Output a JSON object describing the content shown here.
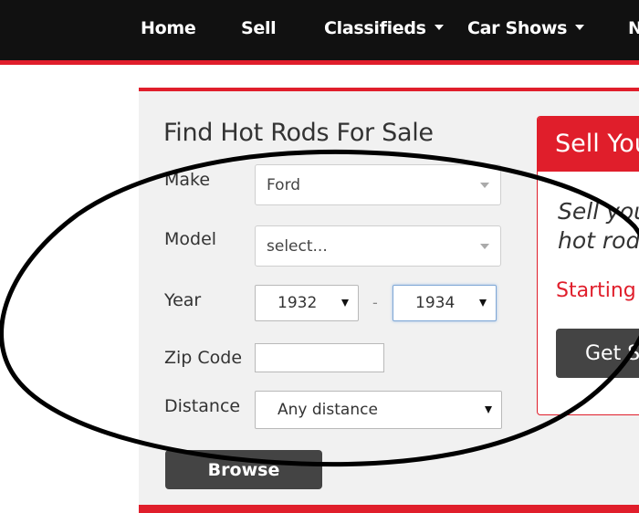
{
  "nav": {
    "home": "Home",
    "sell": "Sell",
    "classifieds": "Classifieds",
    "car_shows": "Car Shows",
    "partial": "N"
  },
  "search": {
    "title": "Find Hot Rods For Sale",
    "make_label": "Make",
    "make_value": "Ford",
    "model_label": "Model",
    "model_value": "select...",
    "year_label": "Year",
    "year_from": "1932",
    "year_separator": "-",
    "year_to": "1934",
    "zip_label": "Zip Code",
    "zip_value": "",
    "distance_label": "Distance",
    "distance_value": "Any distance",
    "browse_label": "Browse"
  },
  "sell": {
    "title": "Sell You",
    "desc_line1": "Sell you",
    "desc_line2": "hot rod",
    "price_text": "Starting a",
    "button_label": "Get S"
  },
  "colors": {
    "accent": "#e01e2b",
    "nav_bg": "#111111",
    "panel_bg": "#f1f1f1",
    "button_bg": "#444444"
  }
}
